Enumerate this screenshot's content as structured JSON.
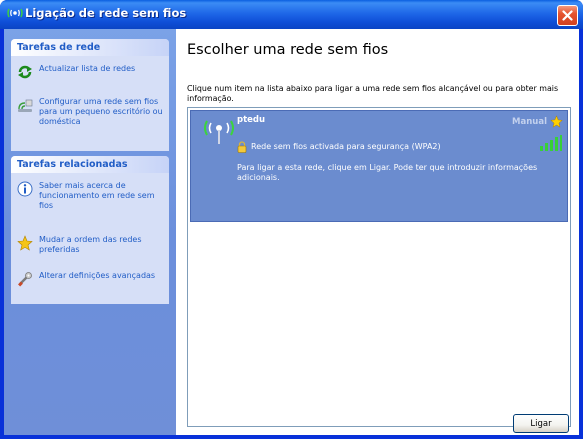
{
  "window": {
    "title": "Ligação de rede sem fios",
    "close_icon": "close-icon"
  },
  "sidebar": {
    "network_tasks": {
      "header": "Tarefas de rede",
      "items": [
        {
          "label": "Actualizar lista de redes",
          "icon": "refresh-icon"
        },
        {
          "label": "Configurar uma rede sem fios para um pequeno escritório ou doméstica",
          "icon": "setup-wizard-icon"
        }
      ]
    },
    "related_tasks": {
      "header": "Tarefas relacionadas",
      "items": [
        {
          "label": "Saber mais acerca de funcionamento em rede sem fios",
          "icon": "info-icon"
        },
        {
          "label": "Mudar a ordem das redes preferidas",
          "icon": "star-icon"
        },
        {
          "label": "Alterar definições avançadas",
          "icon": "settings-icon"
        }
      ]
    }
  },
  "main": {
    "heading": "Escolher uma rede sem fios",
    "description": "Clique num item na lista abaixo para ligar a uma rede sem fios alcançável ou para obter mais informação.",
    "networks": [
      {
        "name": "ptedu",
        "type": "Manual",
        "security": "Rede sem fios activada para segurança (WPA2)",
        "info": "Para ligar a esta rede, clique em Ligar. Pode ter que introduzir informações adicionais."
      }
    ],
    "connect_label": "Ligar"
  },
  "colors": {
    "title_bar": "#1f68e8",
    "sidebar": "#7ba2e7",
    "task_link": "#215dc6",
    "selected_item": "#6b8ccf"
  }
}
